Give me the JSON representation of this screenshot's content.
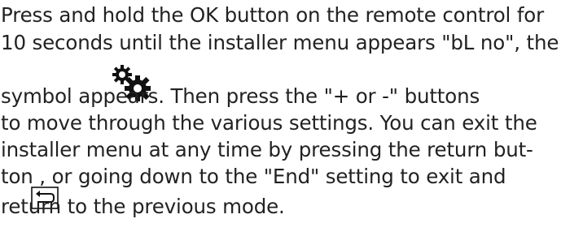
{
  "paragraph": {
    "line1": "Press and hold the OK button on the remote control for",
    "line2": "10 seconds until the installer menu appears \"bL no\", the",
    "line3": "symbol            appears. Then press the \"+ or -\" buttons",
    "line4": "to move through the various settings. You can exit the",
    "line5": "installer menu at any time by pressing the return but-",
    "line6": "ton       , or going down to the \"End\" setting to exit and",
    "line7": "return to the previous mode."
  },
  "icons": {
    "settings": "gear-icon",
    "return": "return-icon"
  },
  "colors": {
    "text": "#222222",
    "icon": "#111111"
  }
}
